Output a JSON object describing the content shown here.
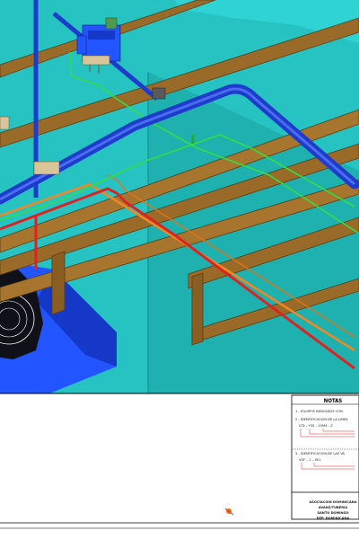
{
  "notes": {
    "title": "NOTAS",
    "items": [
      "1 - EQUIPOS INDICADOS CON",
      "2 - IDENTIFICACION DE LA LINEA",
      "3 - IDENTIFICACION DE LAS VA"
    ],
    "line_code": "LTD – YSS – 10M4 – Z",
    "valve_code": "VGF – 1 – 001"
  },
  "title_block": {
    "line1": "ASOCIACION DOMINICANA",
    "line2": "AVANZ/TUBERIA",
    "line3": "SANTO DOMINGO",
    "line4": "REP. DOMINICANA"
  },
  "colors": {
    "water_tank": "#27c2c2",
    "beam": "#9a6a28",
    "blue_pipe": "#1e3ccc",
    "green_pipe": "#33dd44",
    "red_pipe": "#dd2222",
    "orange_pipe": "#f08822",
    "equipment_blue": "#2255ff"
  }
}
